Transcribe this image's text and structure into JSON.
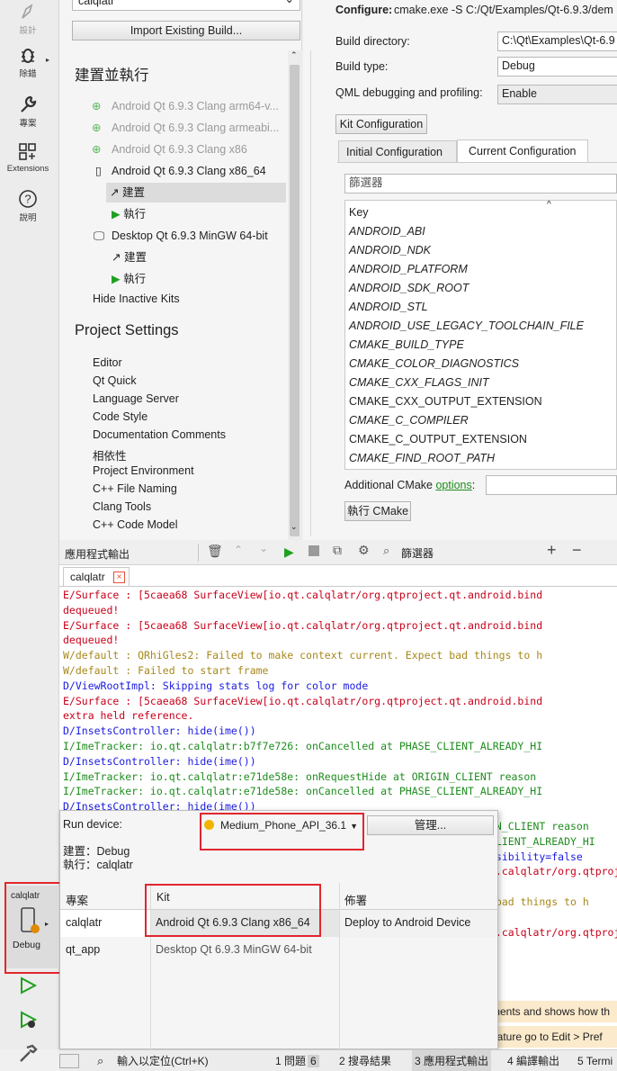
{
  "sidebar": {
    "modes": [
      {
        "label": "設計",
        "icon": "design-icon"
      },
      {
        "label": "除錯",
        "icon": "debug-bug-icon"
      },
      {
        "label": "專案",
        "icon": "projects-wrench-icon"
      },
      {
        "label": "Extensions",
        "icon": "extensions-icon"
      },
      {
        "label": "說明",
        "icon": "help-icon"
      }
    ],
    "target": {
      "project": "calqlatr",
      "mode": "Debug"
    }
  },
  "left_panel": {
    "project_combo": "calqlatr",
    "import_button": "Import Existing Build...",
    "build_run_heading": "建置並執行",
    "kits": [
      {
        "label": "Android Qt 6.9.3 Clang arm64-v...",
        "state": "inactive",
        "icon": "android-add-icon"
      },
      {
        "label": "Android Qt 6.9.3 Clang armeabi...",
        "state": "inactive",
        "icon": "android-add-icon"
      },
      {
        "label": "Android Qt 6.9.3 Clang x86",
        "state": "inactive",
        "icon": "android-add-icon"
      },
      {
        "label": "Android Qt 6.9.3 Clang x86_64",
        "state": "active",
        "icon": "phone-icon"
      },
      {
        "label": "Desktop Qt 6.9.3 MinGW 64-bit",
        "state": "active",
        "icon": "monitor-icon"
      }
    ],
    "kit_children": {
      "build": "建置",
      "run": "執行"
    },
    "hide_inactive": "Hide Inactive Kits",
    "project_settings_heading": "Project Settings",
    "project_settings": [
      "Editor",
      "Qt Quick",
      "Language Server",
      "Code Style",
      "Documentation Comments",
      "相依性",
      "Project Environment",
      "C++ File Naming",
      "Clang Tools",
      "C++ Code Model"
    ]
  },
  "config": {
    "configure_label": "Configure:",
    "configure_cmd": "cmake.exe -S C:/Qt/Examples/Qt-6.9.3/dem",
    "build_dir_label": "Build directory:",
    "build_dir_value": "C:\\Qt\\Examples\\Qt-6.9",
    "build_type_label": "Build type:",
    "build_type_value": "Debug",
    "qml_debug_label": "QML debugging and profiling:",
    "qml_debug_value": "Enable",
    "kit_config_button": "Kit Configuration",
    "tabs": [
      "Initial Configuration",
      "Current Configuration"
    ],
    "filter_placeholder": "篩選器",
    "table_header": "Key",
    "keys": [
      {
        "k": "ANDROID_ABI",
        "italic": true
      },
      {
        "k": "ANDROID_NDK",
        "italic": true
      },
      {
        "k": "ANDROID_PLATFORM",
        "italic": true
      },
      {
        "k": "ANDROID_SDK_ROOT",
        "italic": true
      },
      {
        "k": "ANDROID_STL",
        "italic": true
      },
      {
        "k": "ANDROID_USE_LEGACY_TOOLCHAIN_FILE",
        "italic": true
      },
      {
        "k": "CMAKE_BUILD_TYPE",
        "italic": true
      },
      {
        "k": "CMAKE_COLOR_DIAGNOSTICS",
        "italic": true
      },
      {
        "k": "CMAKE_CXX_FLAGS_INIT",
        "italic": true
      },
      {
        "k": "CMAKE_CXX_OUTPUT_EXTENSION",
        "italic": false
      },
      {
        "k": "CMAKE_C_COMPILER",
        "italic": true
      },
      {
        "k": "CMAKE_C_OUTPUT_EXTENSION",
        "italic": false
      },
      {
        "k": "CMAKE_FIND_ROOT_PATH",
        "italic": true
      }
    ],
    "additional_label": "Additional CMake",
    "additional_link": "options",
    "additional_colon": ":",
    "run_cmake_button": "執行 CMake"
  },
  "output": {
    "title": "應用程式輸出",
    "filter": "篩選器",
    "tab": "calqlatr",
    "lines": [
      {
        "t": "E/Surface : [5caea68 SurfaceView[io.qt.calqlatr/org.qtproject.qt.android.bind",
        "c": "E"
      },
      {
        "t": "dequeued!",
        "c": "E"
      },
      {
        "t": "E/Surface : [5caea68 SurfaceView[io.qt.calqlatr/org.qtproject.qt.android.bind",
        "c": "E"
      },
      {
        "t": "dequeued!",
        "c": "E"
      },
      {
        "t": "W/default : QRhiGles2: Failed to make context current. Expect bad things to h",
        "c": "W"
      },
      {
        "t": "W/default : Failed to start frame",
        "c": "W"
      },
      {
        "t": "D/ViewRootImpl: Skipping stats log for color mode",
        "c": "D"
      },
      {
        "t": "E/Surface : [5caea68 SurfaceView[io.qt.calqlatr/org.qtproject.qt.android.bind",
        "c": "E"
      },
      {
        "t": "extra held reference.",
        "c": "E"
      },
      {
        "t": "D/InsetsController: hide(ime())",
        "c": "D"
      },
      {
        "t": "I/ImeTracker: io.qt.calqlatr:b7f7e726: onCancelled at PHASE_CLIENT_ALREADY_HI",
        "c": "I"
      },
      {
        "t": "D/InsetsController: hide(ime())",
        "c": "D"
      },
      {
        "t": "I/ImeTracker: io.qt.calqlatr:e71de58e: onRequestHide at ORIGIN_CLIENT reason",
        "c": "I"
      },
      {
        "t": "I/ImeTracker: io.qt.calqlatr:e71de58e: onCancelled at PHASE_CLIENT_ALREADY_HI",
        "c": "I"
      },
      {
        "t": "D/InsetsController: hide(ime())",
        "c": "D"
      }
    ],
    "tail": [
      {
        "t": "IN_CLIENT reason",
        "c": "I"
      },
      {
        "t": "CLIENT_ALREADY_HI",
        "c": "I"
      },
      {
        "t": "isibility=false",
        "c": "D"
      },
      {
        "t": "t.calqlatr/org.qtproject.qt.android.bind",
        "c": "E"
      },
      {
        "t": "",
        "c": "E"
      },
      {
        "t": " bad things to h",
        "c": "W"
      },
      {
        "t": "",
        "c": "W"
      },
      {
        "t": "t.calqlatr/org.qtproject.qt.android.bind",
        "c": "E"
      }
    ],
    "notice1": "ments and shows how th",
    "notice2": "eature go to Edit > Pref"
  },
  "popup": {
    "run_device_label": "Run device:",
    "device": "Medium_Phone_API_36.1",
    "manage_button": "管理...",
    "build_line": "建置：Debug",
    "run_line": "執行：calqlatr",
    "headers": [
      "專案",
      "Kit",
      "佈署"
    ],
    "rows": [
      {
        "project": "calqlatr",
        "kit": "Android Qt 6.9.3 Clang x86_64",
        "deploy": "Deploy to Android Device"
      },
      {
        "project": "qt_app",
        "kit": "Desktop Qt 6.9.3 MinGW 64-bit",
        "deploy": ""
      }
    ]
  },
  "status_bar": {
    "locate_placeholder": "輸入以定位(Ctrl+K)",
    "tabs": [
      {
        "num": "1",
        "label": "問題",
        "badge": "6"
      },
      {
        "num": "2",
        "label": "搜尋結果"
      },
      {
        "num": "3",
        "label": "應用程式輸出"
      },
      {
        "num": "4",
        "label": "編譯輸出"
      },
      {
        "num": "5",
        "label": "Termi"
      }
    ]
  },
  "colors": {
    "accent_green": "#20a020",
    "highlight_red": "#e0262e",
    "device_dot": "#f0b400"
  }
}
